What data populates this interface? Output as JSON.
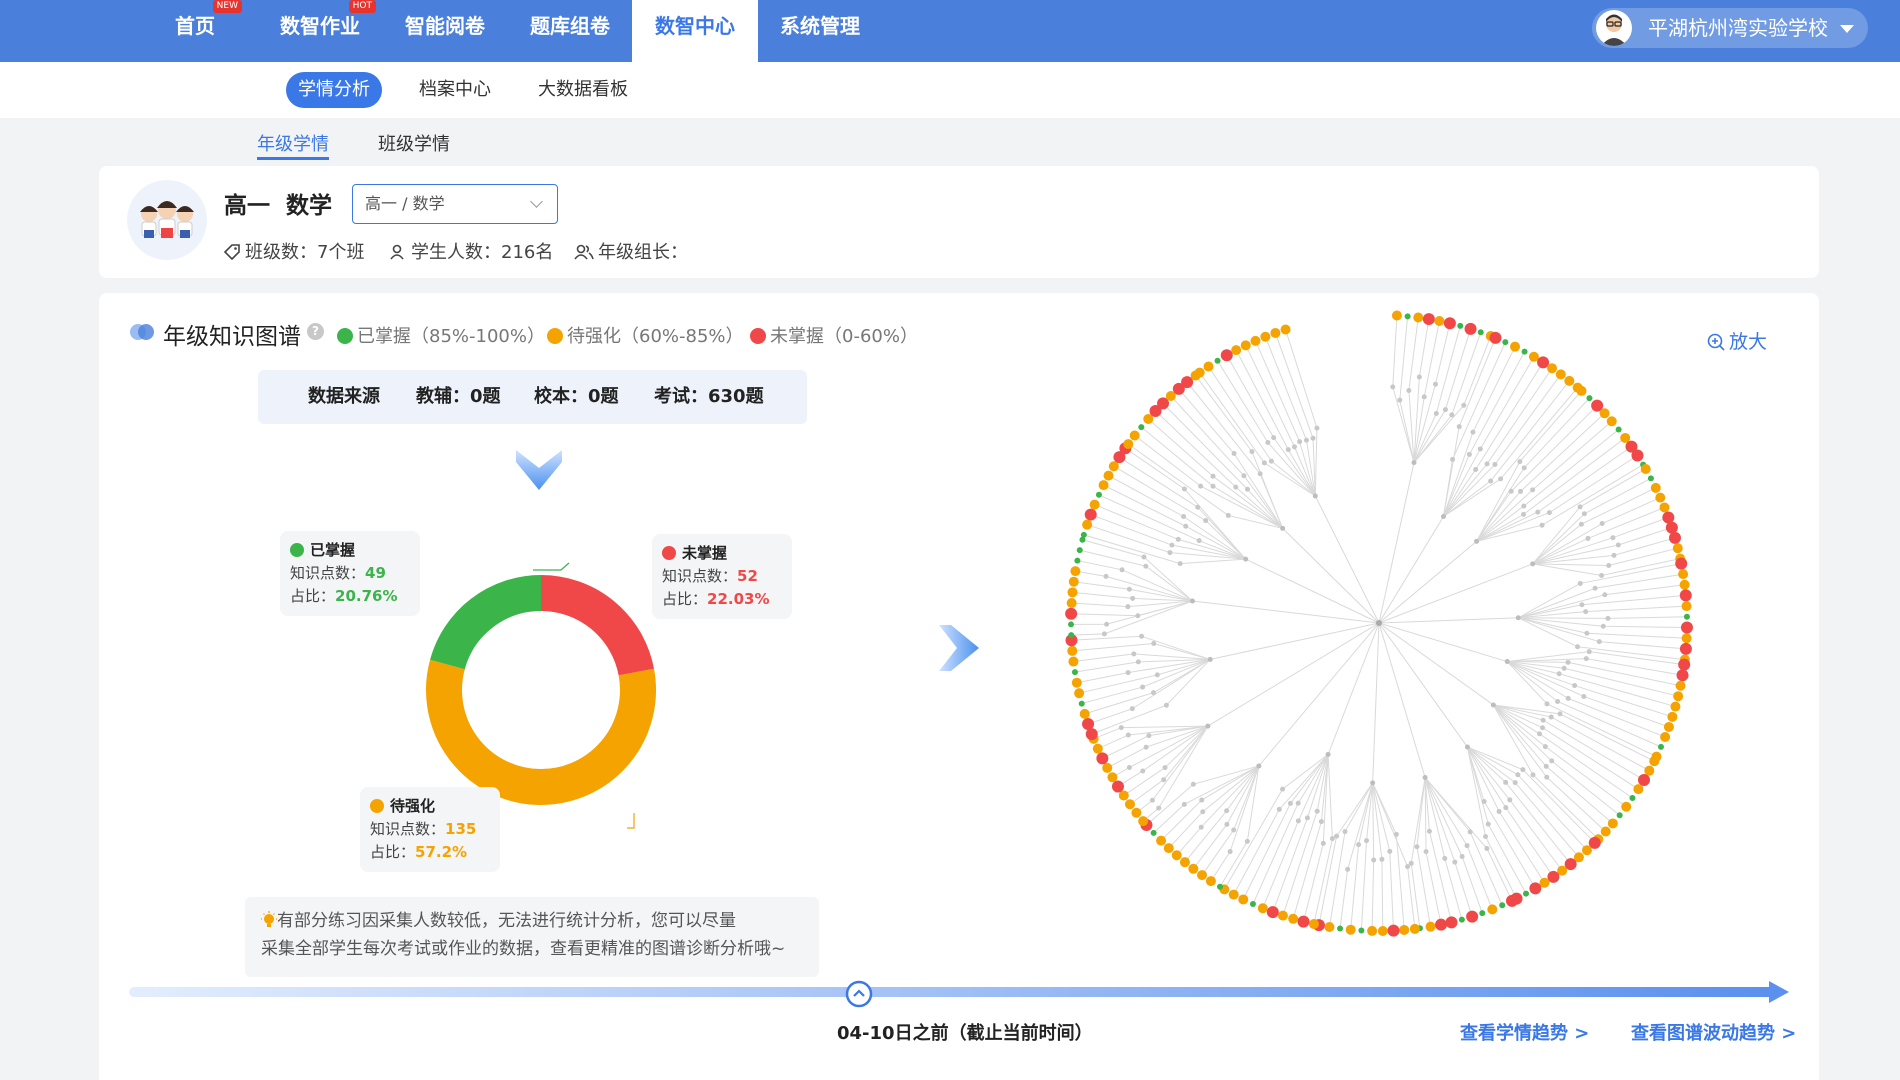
{
  "nav": {
    "items": [
      {
        "label": "首页",
        "badge": "NEW"
      },
      {
        "label": "数智作业",
        "badge": "HOT"
      },
      {
        "label": "智能阅卷",
        "badge": ""
      },
      {
        "label": "题库组卷",
        "badge": ""
      },
      {
        "label": "数智中心",
        "badge": ""
      },
      {
        "label": "系统管理",
        "badge": ""
      }
    ],
    "active": "数智中心",
    "school": "平湖杭州湾实验学校"
  },
  "subnav": {
    "items": [
      "学情分析",
      "档案中心",
      "大数据看板"
    ],
    "active": "学情分析"
  },
  "tabs": {
    "items": [
      "年级学情",
      "班级学情"
    ],
    "active": "年级学情"
  },
  "grade": {
    "title": "高一  数学",
    "select_value": "高一 / 数学",
    "class_count": "班级数：7个班",
    "student_count": "学生人数：216名",
    "leader": "年级组长："
  },
  "graph": {
    "title": "年级知识图谱",
    "legend": [
      {
        "label": "已掌握（85%-100%）",
        "color": "#3bb44a"
      },
      {
        "label": "待强化（60%-85%）",
        "color": "#f4a300"
      },
      {
        "label": "未掌握（0-60%）",
        "color": "#f04848"
      }
    ],
    "source": {
      "label": "数据来源",
      "tutor": "教辅：0题",
      "school": "校本：0题",
      "exam": "考试：630题"
    },
    "zoom": "放大"
  },
  "chart_data": {
    "type": "pie",
    "donut": true,
    "slices": [
      {
        "name": "未掌握",
        "count": 52,
        "percent": 22.03,
        "color": "#f04848"
      },
      {
        "name": "待强化",
        "count": 135,
        "percent": 57.2,
        "color": "#f4a300"
      },
      {
        "name": "已掌握",
        "count": 49,
        "percent": 20.76,
        "color": "#3bb44a"
      }
    ]
  },
  "labels": {
    "mastered": {
      "title": "已掌握",
      "count_label": "知识点数：",
      "count": "49",
      "ratio_label": "占比：",
      "ratio": "20.76%"
    },
    "unmastered": {
      "title": "未掌握",
      "count_label": "知识点数：",
      "count": "52",
      "ratio_label": "占比：",
      "ratio": "22.03%"
    },
    "strengthen": {
      "title": "待强化",
      "count_label": "知识点数：",
      "count": "135",
      "ratio_label": "占比：",
      "ratio": "57.2%"
    }
  },
  "tip": {
    "line1": "有部分练习因采集人数较低，无法进行统计分析，您可以尽量",
    "line2": "采集全部学生每次考试或作业的数据，查看更精准的图谱诊断分析哦~"
  },
  "timeline": {
    "label": "04-10日之前（截止当前时间）",
    "trend_link": "查看学情趋势 >",
    "wave_link": "查看图谱波动趋势 >"
  }
}
